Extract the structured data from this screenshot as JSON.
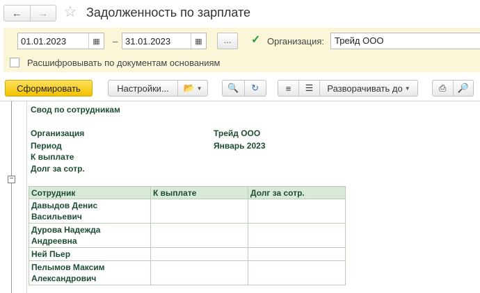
{
  "window": {
    "title": "Задолженность по зарплате"
  },
  "params": {
    "date_from": "01.01.2023",
    "date_separator": "–",
    "date_to": "31.01.2023",
    "ellipsis_label": "...",
    "org_checkbox_checked": true,
    "org_label": "Организация:",
    "org_value": "Трейд ООО",
    "decode_label": "Расшифровывать по документам основаниям",
    "decode_checked": false
  },
  "toolbar": {
    "generate_label": "Сформировать",
    "settings_label": "Настройки...",
    "expand_label": "Разворачивать до"
  },
  "report": {
    "heading": "Свод по сотрудникам",
    "fields": [
      {
        "label": "Организация",
        "value": "Трейд ООО"
      },
      {
        "label": "Период",
        "value": "Январь 2023"
      },
      {
        "label": "К выплате",
        "value": ""
      },
      {
        "label": "Долг за сотр.",
        "value": ""
      }
    ],
    "columns": [
      "Сотрудник",
      "К выплате",
      "Долг за сотр."
    ],
    "rows": [
      {
        "employee": "Давыдов Денис Васильевич",
        "to_pay": "",
        "debt": ""
      },
      {
        "employee": "Дурова Надежда Андреевна",
        "to_pay": "",
        "debt": ""
      },
      {
        "employee": "Ней Пьер",
        "to_pay": "",
        "debt": ""
      },
      {
        "employee": "Пелымов Максим Александрович",
        "to_pay": "",
        "debt": ""
      }
    ]
  },
  "colors": {
    "accent_yellow": "#f2c200",
    "params_bg": "#fbf6d8",
    "report_text": "#1d4d33",
    "table_header_bg": "#d9e9d7",
    "check_green": "#2a9d3a"
  },
  "icons": [
    "back-arrow-icon",
    "forward-arrow-icon",
    "favorite-star-icon",
    "calendar-icon",
    "checkmark-icon",
    "variant-folder-icon",
    "search-icon",
    "search-next-icon",
    "collapse-group-icon",
    "expand-group-icon",
    "print-icon",
    "preview-icon",
    "collapse-minus-icon"
  ]
}
